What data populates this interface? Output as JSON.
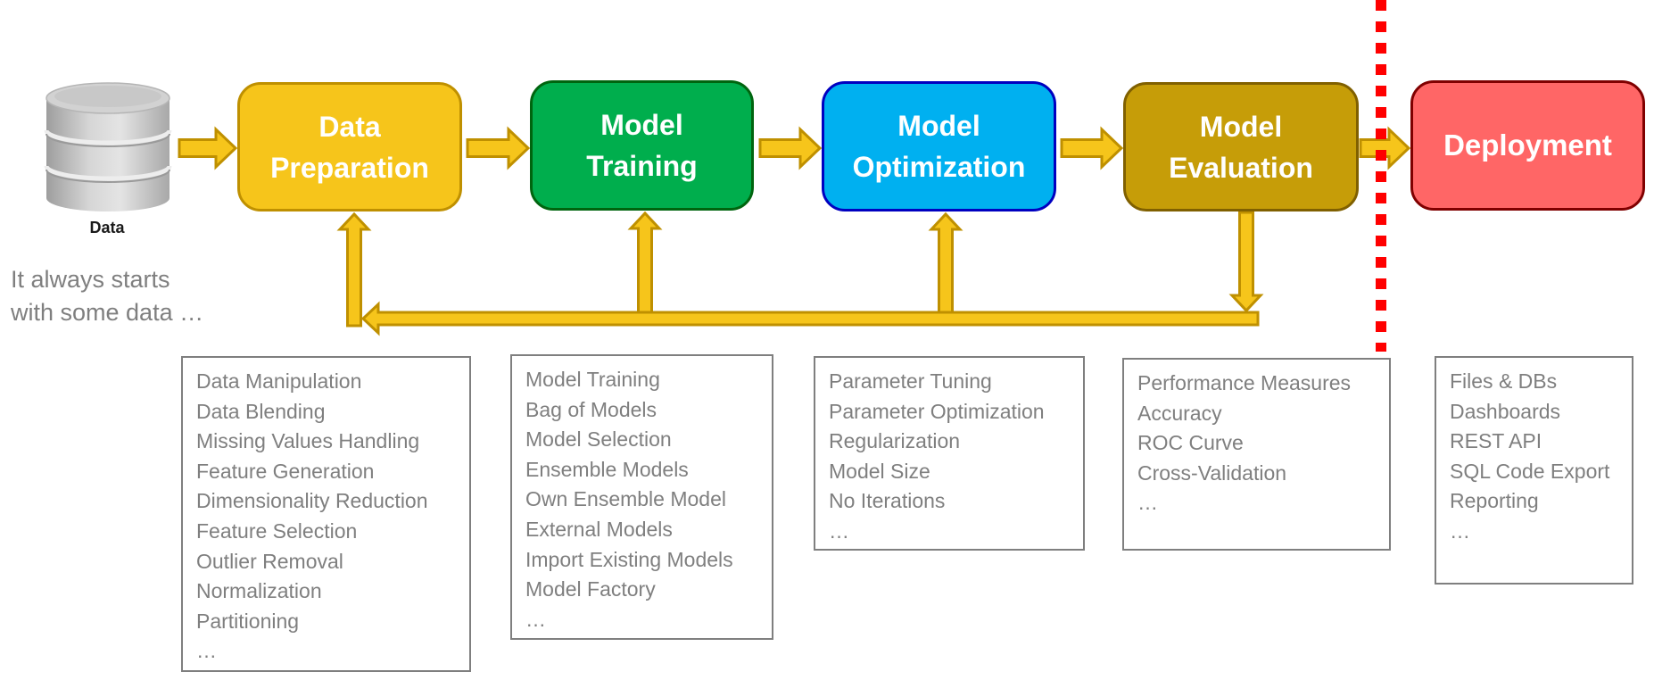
{
  "colors": {
    "arrow_fill": "#F6C51B",
    "arrow_stroke": "#BF9000",
    "divider": "#FF0000",
    "detail_text": "#7F7F7F"
  },
  "source": {
    "icon": "database-icon",
    "label": "Data",
    "caption_lines": [
      "It always starts",
      "with some data …"
    ]
  },
  "stages": [
    {
      "id": "prep",
      "title_lines": [
        "Data",
        "Preparation"
      ],
      "fill": "#F6C51B",
      "border": "#BF9000",
      "details": [
        "Data Manipulation",
        "Data Blending",
        "Missing Values Handling",
        "Feature Generation",
        "Dimensionality Reduction",
        "Feature Selection",
        "Outlier Removal",
        "Normalization",
        "Partitioning",
        "…"
      ]
    },
    {
      "id": "train",
      "title_lines": [
        "Model",
        "Training"
      ],
      "fill": "#00AE4D",
      "border": "#00650F",
      "details": [
        "Model Training",
        "Bag of Models",
        "Model Selection",
        "Ensemble Models",
        "Own Ensemble Model",
        "External Models",
        "Import Existing Models",
        "Model Factory",
        "…"
      ]
    },
    {
      "id": "opt",
      "title_lines": [
        "Model",
        "Optimization"
      ],
      "fill": "#00B0F0",
      "border": "#0000C0",
      "details": [
        "Parameter Tuning",
        "Parameter Optimization",
        "Regularization",
        "Model Size",
        "No Iterations",
        "…"
      ]
    },
    {
      "id": "eval",
      "title_lines": [
        "Model",
        "Evaluation"
      ],
      "fill": "#C69D08",
      "border": "#806000",
      "details": [
        "Performance Measures",
        "Accuracy",
        "ROC Curve",
        "Cross-Validation",
        "…"
      ]
    },
    {
      "id": "deploy",
      "title_lines": [
        "Deployment"
      ],
      "fill": "#FF6666",
      "border": "#800000",
      "details": [
        "Files & DBs",
        "Dashboards",
        "REST API",
        "SQL Code Export",
        "Reporting",
        "…"
      ]
    }
  ],
  "flow": {
    "forward": [
      "source->prep",
      "prep->train",
      "train->opt",
      "opt->eval",
      "eval->deploy"
    ],
    "feedback": [
      "eval->loop",
      "loop->prep",
      "loop->train",
      "loop->opt"
    ]
  }
}
